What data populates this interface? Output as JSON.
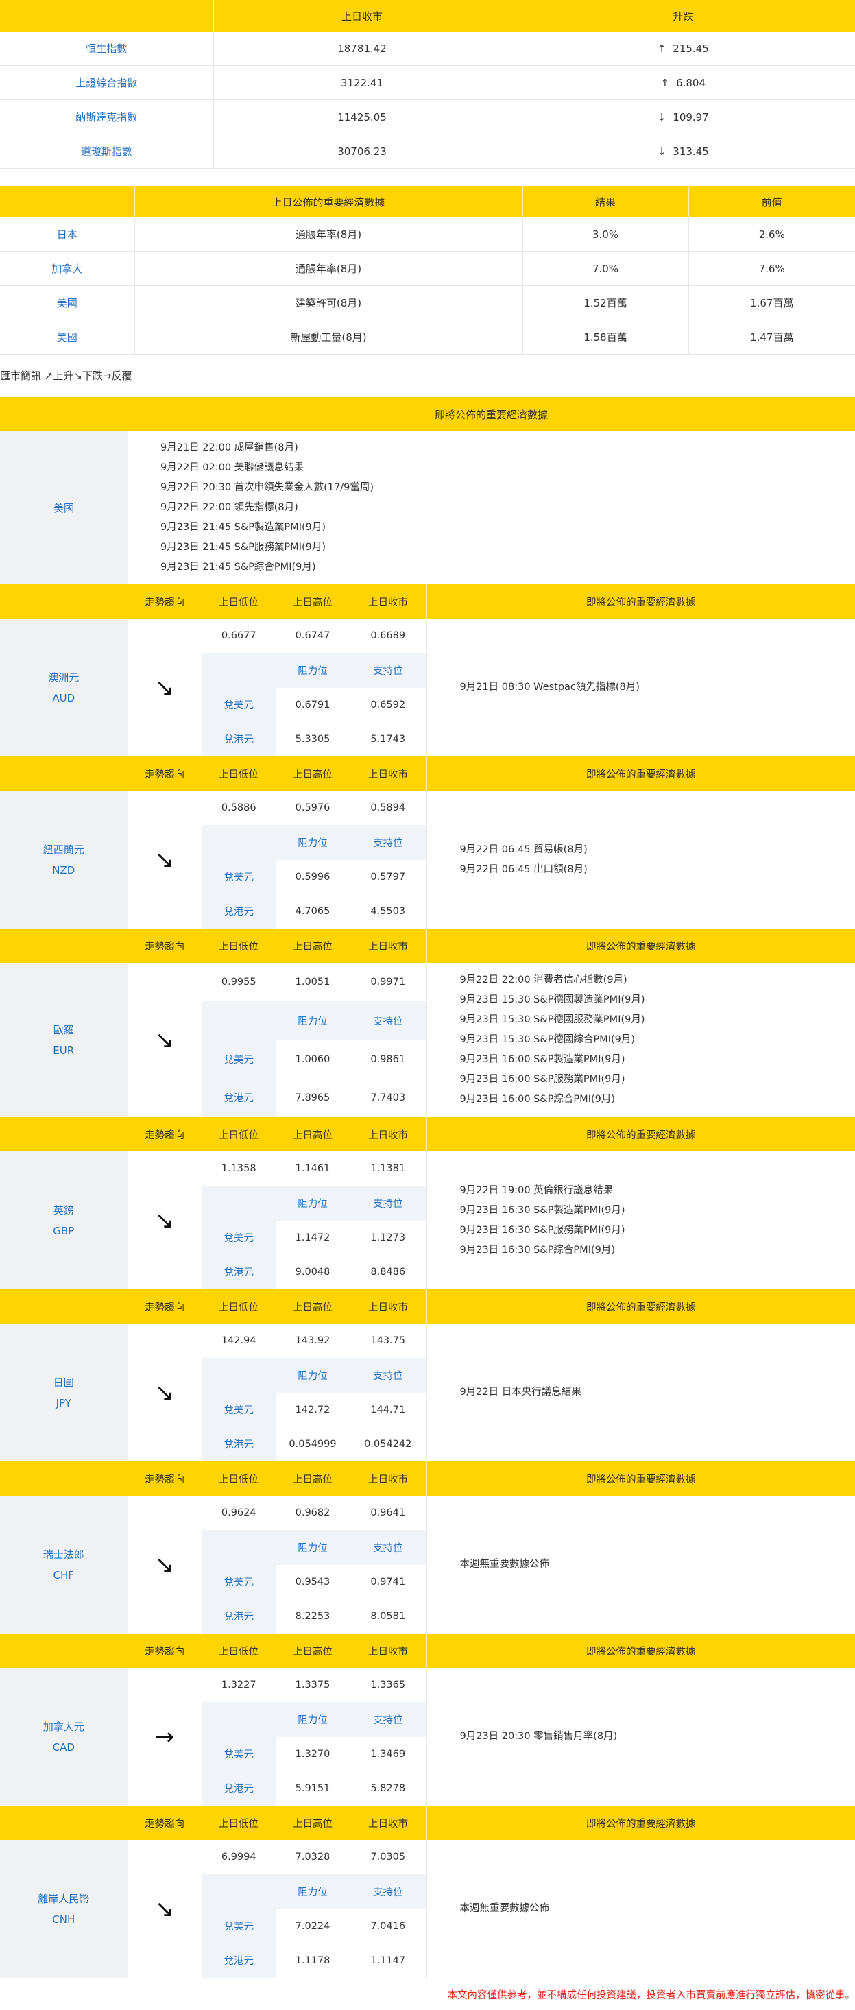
{
  "indices": {
    "headers": [
      "",
      "上日收市",
      "升跌"
    ],
    "rows": [
      {
        "name": "恒生指數",
        "close": "18781.42",
        "arrow": "↑",
        "change": "215.45"
      },
      {
        "name": "上證綜合指數",
        "close": "3122.41",
        "arrow": "↑",
        "change": "6.804"
      },
      {
        "name": "納斯達克指數",
        "close": "11425.05",
        "arrow": "↓",
        "change": "109.97"
      },
      {
        "name": "道瓊斯指數",
        "close": "30706.23",
        "arrow": "↓",
        "change": "313.45"
      }
    ]
  },
  "economic": {
    "headers": [
      "",
      "上日公佈的重要經濟數據",
      "結果",
      "前值"
    ],
    "rows": [
      {
        "country": "日本",
        "item": "通脹年率(8月)",
        "result": "3.0%",
        "previous": "2.6%"
      },
      {
        "country": "加拿大",
        "item": "通脹年率(8月)",
        "result": "7.0%",
        "previous": "7.6%"
      },
      {
        "country": "美國",
        "item": "建築許可(8月)",
        "result": "1.52百萬",
        "previous": "1.67百萬"
      },
      {
        "country": "美國",
        "item": "新屋動工量(8月)",
        "result": "1.58百萬",
        "previous": "1.47百萬"
      }
    ]
  },
  "legend": "匯市簡訊 ↗上升↘下跌→反覆",
  "us_block": {
    "header": "即將公佈的重要經濟數據",
    "country": "美國",
    "events": [
      "9月21日 22:00 成屋銷售(8月)",
      "9月22日 02:00 美聯儲議息結果",
      "9月22日 20:30 首次申領失業金人數(17/9當周)",
      "9月22日 22:00 領先指標(8月)",
      "9月23日 21:45 S&P製造業PMI(9月)",
      "9月23日 21:45 S&P服務業PMI(9月)",
      "9月23日 21:45 S&P綜合PMI(9月)"
    ]
  },
  "currency_headers": {
    "trend": "走勢趨向",
    "low": "上日低位",
    "high": "上日高位",
    "close": "上日收市",
    "events": "即將公佈的重要經濟數據",
    "resistance": "阻力位",
    "support": "支持位",
    "vs_usd": "兌美元",
    "vs_hkd": "兌港元"
  },
  "currencies": [
    {
      "name_zh": "澳洲元",
      "code": "AUD",
      "trend": "↘",
      "low": "0.6677",
      "high": "0.6747",
      "close": "0.6689",
      "usd_res": "0.6791",
      "usd_sup": "0.6592",
      "hkd_res": "5.3305",
      "hkd_sup": "5.1743",
      "events": [
        "9月21日 08:30 Westpac領先指標(8月)"
      ]
    },
    {
      "name_zh": "紐西蘭元",
      "code": "NZD",
      "trend": "↘",
      "low": "0.5886",
      "high": "0.5976",
      "close": "0.5894",
      "usd_res": "0.5996",
      "usd_sup": "0.5797",
      "hkd_res": "4.7065",
      "hkd_sup": "4.5503",
      "events": [
        "9月22日 06:45 貿易帳(8月)",
        "9月22日 06:45 出口額(8月)"
      ]
    },
    {
      "name_zh": "歐羅",
      "code": "EUR",
      "trend": "↘",
      "low": "0.9955",
      "high": "1.0051",
      "close": "0.9971",
      "usd_res": "1.0060",
      "usd_sup": "0.9861",
      "hkd_res": "7.8965",
      "hkd_sup": "7.7403",
      "events": [
        "9月22日 22:00 消費者信心指數(9月)",
        "9月23日 15:30 S&P德國製造業PMI(9月)",
        "9月23日 15:30 S&P德國服務業PMI(9月)",
        "9月23日 15:30 S&P德國綜合PMI(9月)",
        "9月23日 16:00 S&P製造業PMI(9月)",
        "9月23日 16:00 S&P服務業PMI(9月)",
        "9月23日 16:00 S&P綜合PMI(9月)"
      ]
    },
    {
      "name_zh": "英鎊",
      "code": "GBP",
      "trend": "↘",
      "low": "1.1358",
      "high": "1.1461",
      "close": "1.1381",
      "usd_res": "1.1472",
      "usd_sup": "1.1273",
      "hkd_res": "9.0048",
      "hkd_sup": "8.8486",
      "events": [
        "9月22日 19:00 英倫銀行議息結果",
        "9月23日 16:30 S&P製造業PMI(9月)",
        "9月23日 16:30 S&P服務業PMI(9月)",
        "9月23日 16:30 S&P綜合PMI(9月)"
      ]
    },
    {
      "name_zh": "日圓",
      "code": "JPY",
      "trend": "↘",
      "low": "142.94",
      "high": "143.92",
      "close": "143.75",
      "usd_res": "142.72",
      "usd_sup": "144.71",
      "hkd_res": "0.054999",
      "hkd_sup": "0.054242",
      "events": [
        "9月22日 日本央行議息結果"
      ]
    },
    {
      "name_zh": "瑞士法郎",
      "code": "CHF",
      "trend": "↘",
      "low": "0.9624",
      "high": "0.9682",
      "close": "0.9641",
      "usd_res": "0.9543",
      "usd_sup": "0.9741",
      "hkd_res": "8.2253",
      "hkd_sup": "8.0581",
      "events": [
        "本週無重要數據公佈"
      ]
    },
    {
      "name_zh": "加拿大元",
      "code": "CAD",
      "trend": "→",
      "low": "1.3227",
      "high": "1.3375",
      "close": "1.3365",
      "usd_res": "1.3270",
      "usd_sup": "1.3469",
      "hkd_res": "5.9151",
      "hkd_sup": "5.8278",
      "events": [
        "9月23日 20:30 零售銷售月率(8月)"
      ]
    },
    {
      "name_zh": "離岸人民幣",
      "code": "CNH",
      "trend": "↘",
      "low": "6.9994",
      "high": "7.0328",
      "close": "7.0305",
      "usd_res": "7.0224",
      "usd_sup": "7.0416",
      "hkd_res": "1.1178",
      "hkd_sup": "1.1147",
      "events": [
        "本週無重要數據公佈"
      ]
    }
  ],
  "disclaimer": "本文內容僅供參考，並不構成任何投資建議，投資者入市買賣前應進行獨立評估，慎密從事。"
}
